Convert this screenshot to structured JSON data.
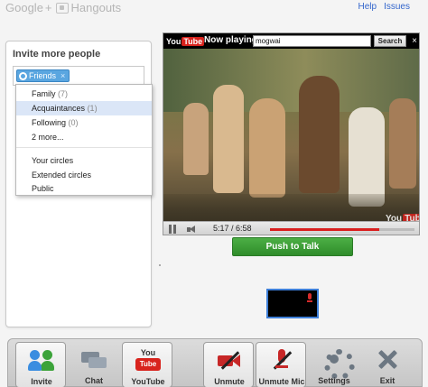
{
  "header": {
    "brand_google": "Google",
    "brand_plus": "+",
    "brand_hangouts": "Hangouts",
    "links": [
      "Help",
      "Issues"
    ]
  },
  "invite": {
    "title": "Invite more people",
    "chip_label": "Friends",
    "chip_remove": "×"
  },
  "circle_menu": {
    "items": [
      {
        "label": "Family",
        "count": "(7)"
      },
      {
        "label": "Acquaintances",
        "count": "(1)"
      },
      {
        "label": "Following",
        "count": "(0)"
      },
      {
        "label": "2 more...",
        "count": ""
      }
    ],
    "groups": [
      "Your circles",
      "Extended circles",
      "Public"
    ],
    "selected": "Acquaintances"
  },
  "youtube": {
    "logo_you": "You",
    "logo_tube": "Tube",
    "now_playing": "Now playing",
    "search_value": "mogwai",
    "search_button": "Search",
    "close": "×",
    "time_label": "5:17 / 6:58",
    "progress": 0.757
  },
  "push_to_talk": "Push to Talk",
  "toolbar": {
    "invite": "Invite",
    "chat": "Chat",
    "youtube": "YouTube",
    "yt_icon_top": "You",
    "yt_icon_bottom": "Tube",
    "unmute_video": "Unmute Video",
    "unmute_mic": "Unmute Mic",
    "settings": "Settings",
    "exit": "Exit"
  },
  "colors": {
    "accent_blue": "#3366cc",
    "push_to_talk_green": "#3b9b35",
    "youtube_red": "#d8231d",
    "mute_red": "#c72727"
  }
}
